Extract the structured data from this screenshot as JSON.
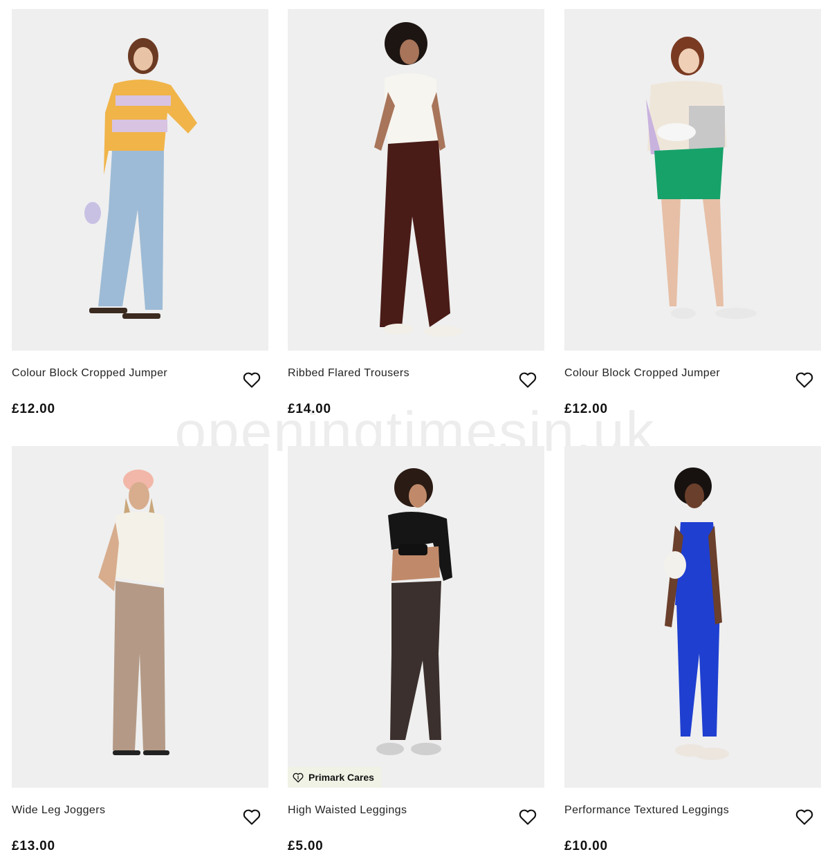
{
  "products": [
    {
      "name": "Colour Block Cropped Jumper",
      "price": "£12.00"
    },
    {
      "name": "Ribbed Flared Trousers",
      "price": "£14.00"
    },
    {
      "name": "Colour Block Cropped Jumper",
      "price": "£12.00"
    },
    {
      "name": "Wide Leg Joggers",
      "price": "£13.00"
    },
    {
      "name": "High Waisted Leggings",
      "price": "£5.00",
      "badge": "Primark Cares"
    },
    {
      "name": "Performance Textured Leggings",
      "price": "£10.00"
    }
  ],
  "watermark": "openingtimesin.uk",
  "icons": {
    "wishlist": "heart-outline-icon",
    "badge": "heart-leaf-icon"
  },
  "colors": {
    "image_bg": "#efefef",
    "badge_bg": "#f1f2e6",
    "text": "#111111"
  }
}
